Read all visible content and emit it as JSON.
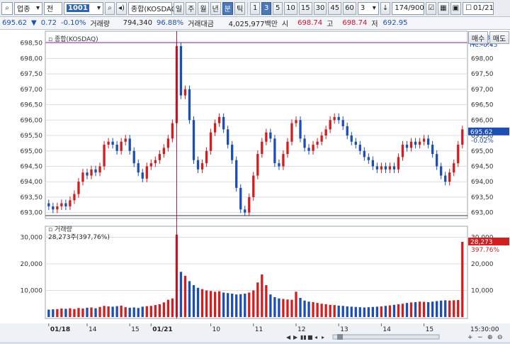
{
  "toolbar": {
    "market_select": "업종",
    "price_type": "전",
    "code": "1001",
    "index_name": "종합(KOSDAQ)",
    "period_tabs": [
      "일",
      "주",
      "월",
      "년",
      "분",
      "틱"
    ],
    "active_period": "분",
    "minute_options": [
      "1",
      "3",
      "5",
      "10",
      "15",
      "30",
      "45",
      "60"
    ],
    "active_minute": "3",
    "interval_value": "3",
    "count_display": "174/900",
    "date_value": "01/21"
  },
  "infobar": {
    "current": "695.62",
    "change": "0.72",
    "change_pct": "-0.10%",
    "volume_label": "거래량",
    "volume": "794,340",
    "volume_ratio": "96.88%",
    "amount_label": "거래대금",
    "amount": "4,025,977백만",
    "open_label": "시",
    "open": "698.74",
    "high_label": "고",
    "high": "698.74",
    "low_label": "저",
    "low": "692.95",
    "buy_button": "매수",
    "sell_button": "매도"
  },
  "chart_data": [
    {
      "type": "candlestick",
      "title": "종합(KOSDAQ)",
      "ylim": [
        692.9,
        698.7
      ],
      "y_ticks": [
        "693,00",
        "693,50",
        "694,00",
        "694,50",
        "695,00",
        "695,50",
        "696,00",
        "696,50",
        "697,00",
        "697,50",
        "698,00",
        "698,50"
      ],
      "x_tick_labels": [
        "01/18",
        "14",
        "15",
        "01/21",
        "10",
        "11",
        "12",
        "13",
        "14",
        "15"
      ],
      "right_labels": {
        "lc": "LC:0.39",
        "hc": "HC:-0.45",
        "current": "695.62",
        "current_change": "-0.02%"
      },
      "close_series": [
        693.2,
        693.1,
        693.2,
        693.3,
        693.2,
        693.4,
        693.6,
        694.0,
        694.3,
        694.2,
        694.4,
        694.3,
        694.5,
        695.2,
        695.3,
        695.2,
        695.0,
        695.3,
        695.4,
        695.0,
        694.6,
        694.3,
        694.1,
        694.5,
        694.6,
        694.7,
        694.9,
        695.1,
        695.4,
        695.9,
        698.4,
        696.8,
        697.0,
        696.0,
        694.7,
        694.4,
        694.6,
        695.0,
        695.6,
        695.9,
        696.1,
        695.7,
        695.2,
        694.7,
        693.8,
        693.1,
        693.0,
        693.5,
        694.2,
        694.9,
        695.3,
        695.6,
        695.4,
        694.6,
        694.5,
        694.9,
        695.3,
        695.9,
        696.0,
        695.4,
        695.1,
        695.0,
        695.2,
        695.3,
        695.5,
        695.7,
        696.0,
        696.1,
        696.0,
        695.8,
        695.5,
        695.3,
        695.2,
        695.0,
        694.8,
        694.7,
        694.5,
        694.4,
        694.5,
        694.4,
        694.5,
        694.4,
        694.8,
        695.2,
        695.1,
        695.3,
        695.2,
        695.3,
        695.4,
        695.2,
        694.9,
        694.5,
        694.2,
        694.0,
        694.3,
        694.6,
        695.2,
        695.7
      ],
      "open_series": [
        693.3,
        693.2,
        693.1,
        693.2,
        693.3,
        693.2,
        693.4,
        693.6,
        694.0,
        694.3,
        694.2,
        694.4,
        694.3,
        694.5,
        695.2,
        695.3,
        695.2,
        695.0,
        695.3,
        695.4,
        695.0,
        694.6,
        694.3,
        694.1,
        694.5,
        694.6,
        694.7,
        694.9,
        695.1,
        695.4,
        695.9,
        698.4,
        696.8,
        697.0,
        696.0,
        694.7,
        694.4,
        694.6,
        695.0,
        695.6,
        695.9,
        696.1,
        695.7,
        695.2,
        694.7,
        693.8,
        693.1,
        693.0,
        693.5,
        694.2,
        694.9,
        695.3,
        695.6,
        695.4,
        694.6,
        694.5,
        694.9,
        695.3,
        695.9,
        696.0,
        695.4,
        695.1,
        695.0,
        695.2,
        695.3,
        695.5,
        695.7,
        696.0,
        696.1,
        696.0,
        695.8,
        695.5,
        695.3,
        695.2,
        695.0,
        694.8,
        694.7,
        694.5,
        694.4,
        694.5,
        694.4,
        694.5,
        694.4,
        694.8,
        695.2,
        695.1,
        695.3,
        695.2,
        695.3,
        695.4,
        695.2,
        694.9,
        694.5,
        694.2,
        694.0,
        694.3,
        694.6,
        695.2
      ]
    },
    {
      "type": "bar",
      "title": "거래량",
      "summary": "28,273주(397,76%)",
      "ylim": [
        0,
        32000
      ],
      "y_ticks": [
        "10,000",
        "20,000",
        "30,000"
      ],
      "right_labels": {
        "current": "28,273",
        "pct": "397.76%"
      },
      "values": [
        2800,
        2900,
        3000,
        3200,
        3100,
        3300,
        3000,
        3400,
        3200,
        3500,
        3600,
        3300,
        3800,
        4200,
        4000,
        3900,
        4100,
        4300,
        3700,
        3500,
        3600,
        3400,
        3900,
        4100,
        4200,
        4500,
        4800,
        5500,
        6500,
        7000,
        31000,
        17000,
        15500,
        13500,
        12000,
        11000,
        10500,
        10000,
        9800,
        9500,
        9700,
        9200,
        9000,
        8800,
        8500,
        8600,
        8800,
        9200,
        10000,
        13000,
        16000,
        12000,
        8500,
        7500,
        7000,
        6800,
        6600,
        6500,
        9500,
        7200,
        6200,
        5800,
        5600,
        5300,
        5000,
        4800,
        4600,
        4500,
        4300,
        4200,
        4000,
        3900,
        3800,
        3700,
        3600,
        3700,
        3800,
        3900,
        4000,
        4200,
        4400,
        4600,
        4800,
        5000,
        5300,
        5500,
        5600,
        5800,
        5700,
        5600,
        5800,
        6000,
        6200,
        6300,
        6200,
        6300,
        6400,
        28273
      ],
      "up_mask": "candle"
    }
  ],
  "status": {
    "time": "15:30:00"
  },
  "colors": {
    "up": "#d21e1e",
    "down": "#1c4fb5",
    "grid": "#d8dde3",
    "baseline": "#b44fc8"
  }
}
